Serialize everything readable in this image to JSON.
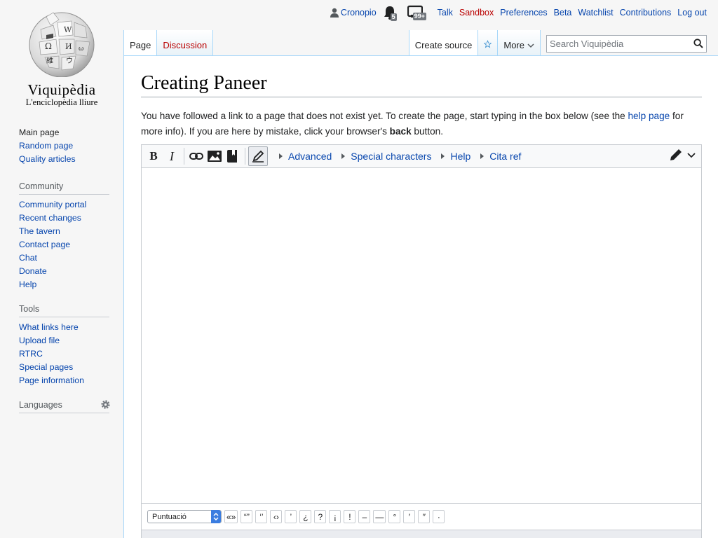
{
  "logo": {
    "wordmark": "Viquipèdia",
    "tagline": "L'enciclopèdia lliure"
  },
  "personal": {
    "username": "Cronopio",
    "alerts_count": "5",
    "notices_count": "99+",
    "talk": "Talk",
    "sandbox": "Sandbox",
    "preferences": "Preferences",
    "beta": "Beta",
    "watchlist": "Watchlist",
    "contributions": "Contributions",
    "logout": "Log out"
  },
  "tabs": {
    "page": "Page",
    "discussion": "Discussion",
    "create_source": "Create source",
    "more": "More"
  },
  "search": {
    "placeholder": "Search Viquipèdia"
  },
  "sidebar": {
    "nav": [
      "Main page",
      "Random page",
      "Quality articles"
    ],
    "community_heading": "Community",
    "community": [
      "Community portal",
      "Recent changes",
      "The tavern",
      "Contact page",
      "Chat",
      "Donate",
      "Help"
    ],
    "tools_heading": "Tools",
    "tools": [
      "What links here",
      "Upload file",
      "RTRC",
      "Special pages",
      "Page information"
    ],
    "languages_heading": "Languages"
  },
  "page": {
    "title": "Creating Paneer",
    "intro_1": "You have followed a link to a page that does not exist yet. To create the page, start typing in the box below (see the ",
    "help_link": "help page",
    "intro_2": " for more info). If you are here by mistake, click your browser's ",
    "back": "back",
    "intro_3": " button."
  },
  "toolbar": {
    "bold": "B",
    "italic": "I",
    "advanced": "Advanced",
    "special_characters": "Special characters",
    "help": "Help",
    "cita_ref": "Cita ref"
  },
  "editor": {
    "content": ""
  },
  "special_chars": {
    "category": "Puntuació",
    "chars": [
      "«»",
      "“”",
      "‘’",
      "‹›",
      "’",
      "¿",
      "?",
      "¡",
      "!",
      "–",
      "—",
      "°",
      "′",
      "″",
      "·"
    ]
  }
}
